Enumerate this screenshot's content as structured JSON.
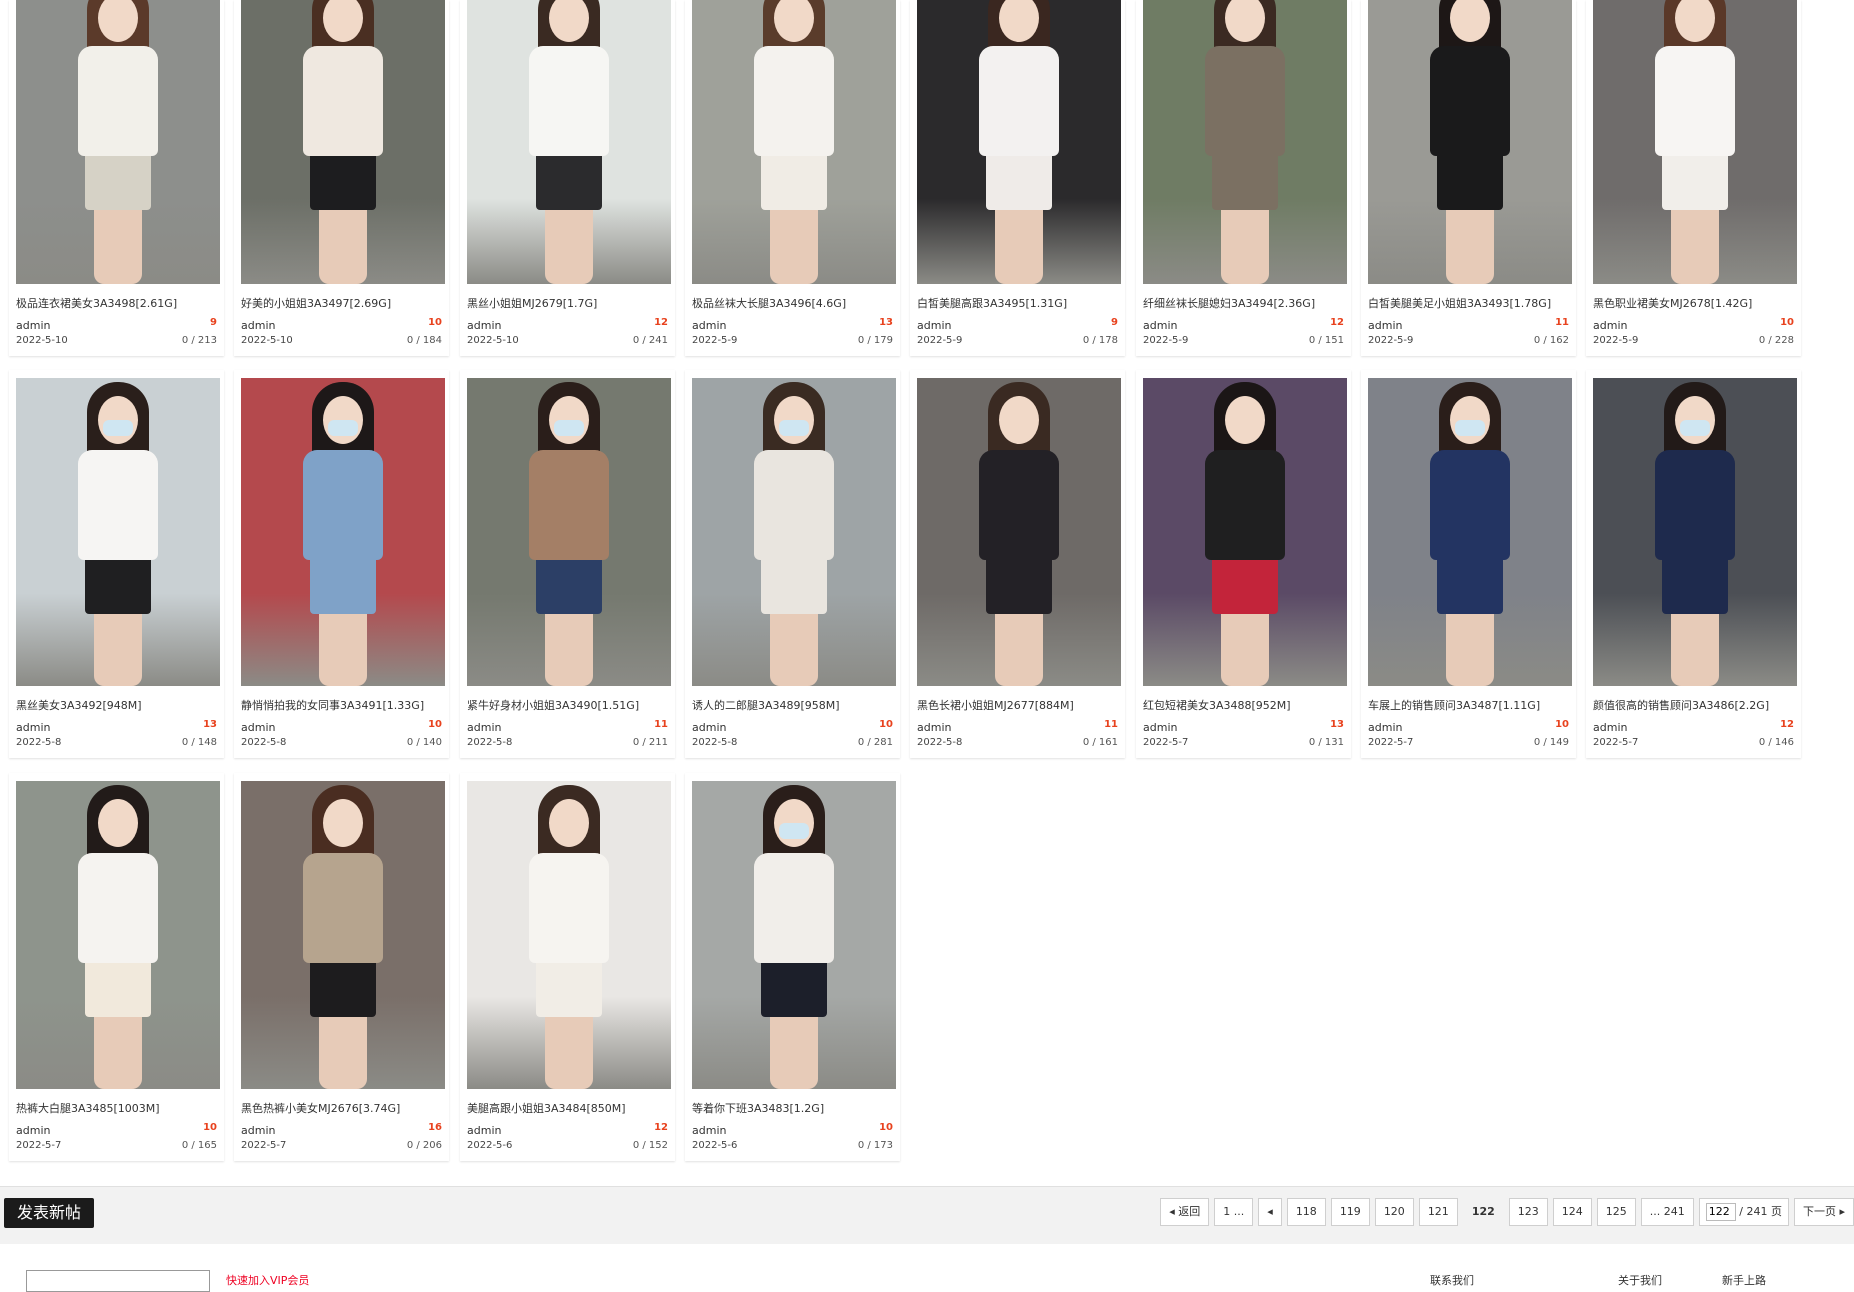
{
  "posts": [
    {
      "title": "极品连衣裙美女3A3498[2.61G]",
      "author": "admin",
      "replies": "9",
      "date": "2022-5-10",
      "views": "0 / 213",
      "palette": [
        "#8d8f8c",
        "#f2f0ea",
        "#d6d2c6",
        "#5b3a2a"
      ]
    },
    {
      "title": "好美的小姐姐3A3497[2.69G]",
      "author": "admin",
      "replies": "10",
      "date": "2022-5-10",
      "views": "0 / 184",
      "palette": [
        "#6c6f67",
        "#efe8e0",
        "#1d1d1f",
        "#4a2f22"
      ]
    },
    {
      "title": "黑丝小姐姐MJ2679[1.7G]",
      "author": "admin",
      "replies": "12",
      "date": "2022-5-10",
      "views": "0 / 241",
      "palette": [
        "#dfe3e0",
        "#f6f6f3",
        "#2b2b2d",
        "#3a2a22"
      ]
    },
    {
      "title": "极品丝袜大长腿3A3496[4.6G]",
      "author": "admin",
      "replies": "13",
      "date": "2022-5-9",
      "views": "0 / 179",
      "palette": [
        "#9fa19a",
        "#f4f2ee",
        "#f0ece5",
        "#5a3c2b"
      ]
    },
    {
      "title": "白皙美腿高跟3A3495[1.31G]",
      "author": "admin",
      "replies": "9",
      "date": "2022-5-9",
      "views": "0 / 178",
      "palette": [
        "#2b2a2c",
        "#f3f1f0",
        "#efebe8",
        "#3a2720"
      ]
    },
    {
      "title": "纤细丝袜长腿媳妇3A3494[2.36G]",
      "author": "admin",
      "replies": "12",
      "date": "2022-5-9",
      "views": "0 / 151",
      "palette": [
        "#6f7c64",
        "#7b7062",
        "#7b7062",
        "#3b2a22"
      ]
    },
    {
      "title": "白皙美腿美足小姐姐3A3493[1.78G]",
      "author": "admin",
      "replies": "11",
      "date": "2022-5-9",
      "views": "0 / 162",
      "palette": [
        "#9a9a95",
        "#1a1a1b",
        "#1a1a1b",
        "#1d1716"
      ]
    },
    {
      "title": "黑色职业裙美女MJ2678[1.42G]",
      "author": "admin",
      "replies": "10",
      "date": "2022-5-9",
      "views": "0 / 228",
      "palette": [
        "#6f6c6b",
        "#f7f5f3",
        "#f1eeea",
        "#5a3828"
      ]
    },
    {
      "title": "黑丝美女3A3492[948M]",
      "author": "admin",
      "replies": "13",
      "date": "2022-5-8",
      "views": "0 / 148",
      "palette": [
        "#c9d0d3",
        "#f6f5f3",
        "#1f1f21",
        "#2a1f1b"
      ],
      "mask": true
    },
    {
      "title": "静悄悄拍我的女同事3A3491[1.33G]",
      "author": "admin",
      "replies": "10",
      "date": "2022-5-8",
      "views": "0 / 140",
      "palette": [
        "#b4494d",
        "#7fa2c8",
        "#7fa2c8",
        "#1d1818"
      ],
      "mask": true
    },
    {
      "title": "紧牛好身材小姐姐3A3490[1.51G]",
      "author": "admin",
      "replies": "11",
      "date": "2022-5-8",
      "views": "0 / 211",
      "palette": [
        "#75796f",
        "#a47f66",
        "#2c3f66",
        "#2a1e1a"
      ],
      "mask": true
    },
    {
      "title": "诱人的二郎腿3A3489[958M]",
      "author": "admin",
      "replies": "10",
      "date": "2022-5-8",
      "views": "0 / 281",
      "palette": [
        "#9ea4a6",
        "#e9e5df",
        "#e9e5df",
        "#3a2b22"
      ],
      "mask": true
    },
    {
      "title": "黑色长裙小姐姐MJ2677[884M]",
      "author": "admin",
      "replies": "11",
      "date": "2022-5-8",
      "views": "0 / 161",
      "palette": [
        "#6e6a67",
        "#232126",
        "#232126",
        "#3a2a22"
      ]
    },
    {
      "title": "红包短裙美女3A3488[952M]",
      "author": "admin",
      "replies": "13",
      "date": "2022-5-7",
      "views": "0 / 131",
      "palette": [
        "#5b4a66",
        "#1f1f20",
        "#c3243a",
        "#1b1616"
      ]
    },
    {
      "title": "车展上的销售顾问3A3487[1.11G]",
      "author": "admin",
      "replies": "10",
      "date": "2022-5-7",
      "views": "0 / 149",
      "palette": [
        "#7f8289",
        "#233462",
        "#233462",
        "#2a1e1a"
      ],
      "mask": true
    },
    {
      "title": "颜值很高的销售顾问3A3486[2.2G]",
      "author": "admin",
      "replies": "12",
      "date": "2022-5-7",
      "views": "0 / 146",
      "palette": [
        "#4c4f55",
        "#1e2a4d",
        "#1e2a4d",
        "#221a18"
      ],
      "mask": true
    },
    {
      "title": "热裤大白腿3A3485[1003M]",
      "author": "admin",
      "replies": "10",
      "date": "2022-5-7",
      "views": "0 / 165",
      "palette": [
        "#8e948c",
        "#f5f3f0",
        "#f1e9dc",
        "#221b19"
      ]
    },
    {
      "title": "黑色热裤小美女MJ2676[3.74G]",
      "author": "admin",
      "replies": "16",
      "date": "2022-5-7",
      "views": "0 / 206",
      "palette": [
        "#7a6f69",
        "#b6a48e",
        "#1d1c1e",
        "#4a2d21"
      ]
    },
    {
      "title": "美腿高跟小姐姐3A3484[850M]",
      "author": "admin",
      "replies": "12",
      "date": "2022-5-6",
      "views": "0 / 152",
      "palette": [
        "#e9e7e4",
        "#f6f4f0",
        "#f1ede6",
        "#3b2a22"
      ]
    },
    {
      "title": "等着你下班3A3483[1.2G]",
      "author": "admin",
      "replies": "10",
      "date": "2022-5-6",
      "views": "0 / 173",
      "palette": [
        "#a5a8a6",
        "#f1eeea",
        "#1c1f2a",
        "#2a1e1a"
      ],
      "mask": true
    }
  ],
  "toolbar": {
    "new_post": "发表新帖"
  },
  "pagination": {
    "back": "◂ 返回",
    "first": "1 ...",
    "prev": "◂",
    "pages": [
      "118",
      "119",
      "120",
      "121",
      "122",
      "123",
      "124",
      "125"
    ],
    "current": "122",
    "last": "... 241",
    "jump_value": "122",
    "total": " / 241 页",
    "next": "下一页 ▸"
  },
  "footer": {
    "vip_link": "快速加入VIP会员",
    "about_left": "联系我们",
    "about_mid": "关于我们",
    "about_right": "新手上路"
  }
}
